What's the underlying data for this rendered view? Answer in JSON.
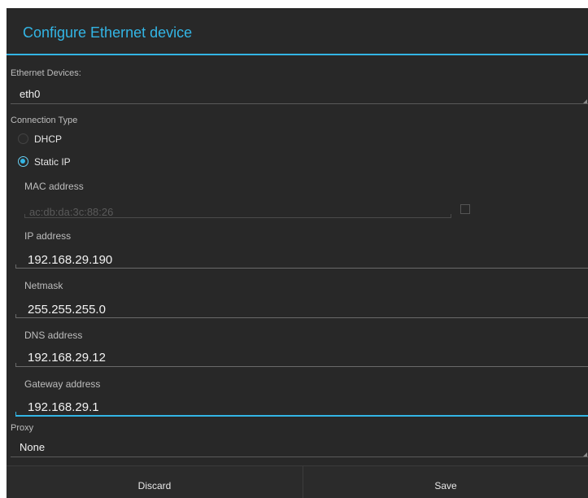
{
  "dialog": {
    "title": "Configure Ethernet device"
  },
  "ethernet_devices": {
    "label": "Ethernet Devices:",
    "selected": "eth0"
  },
  "connection_type": {
    "label": "Connection Type",
    "options": [
      {
        "label": "DHCP",
        "selected": false
      },
      {
        "label": "Static IP",
        "selected": true
      }
    ]
  },
  "mac_address": {
    "label": "MAC address",
    "value": "ac:db:da:3c:88:26",
    "enabled": false,
    "checkbox_checked": false
  },
  "ip_address": {
    "label": "IP address",
    "value": "192.168.29.190"
  },
  "netmask": {
    "label": "Netmask",
    "value": "255.255.255.0"
  },
  "dns_address": {
    "label": "DNS address",
    "value": "192.168.29.12"
  },
  "gateway_address": {
    "label": "Gateway address",
    "value": "192.168.29.1",
    "focused": true
  },
  "proxy": {
    "label": "Proxy",
    "selected": "None"
  },
  "buttons": {
    "discard": "Discard",
    "save": "Save"
  },
  "colors": {
    "accent": "#33b5e5",
    "background": "#282828",
    "text": "#f2f2f2"
  }
}
